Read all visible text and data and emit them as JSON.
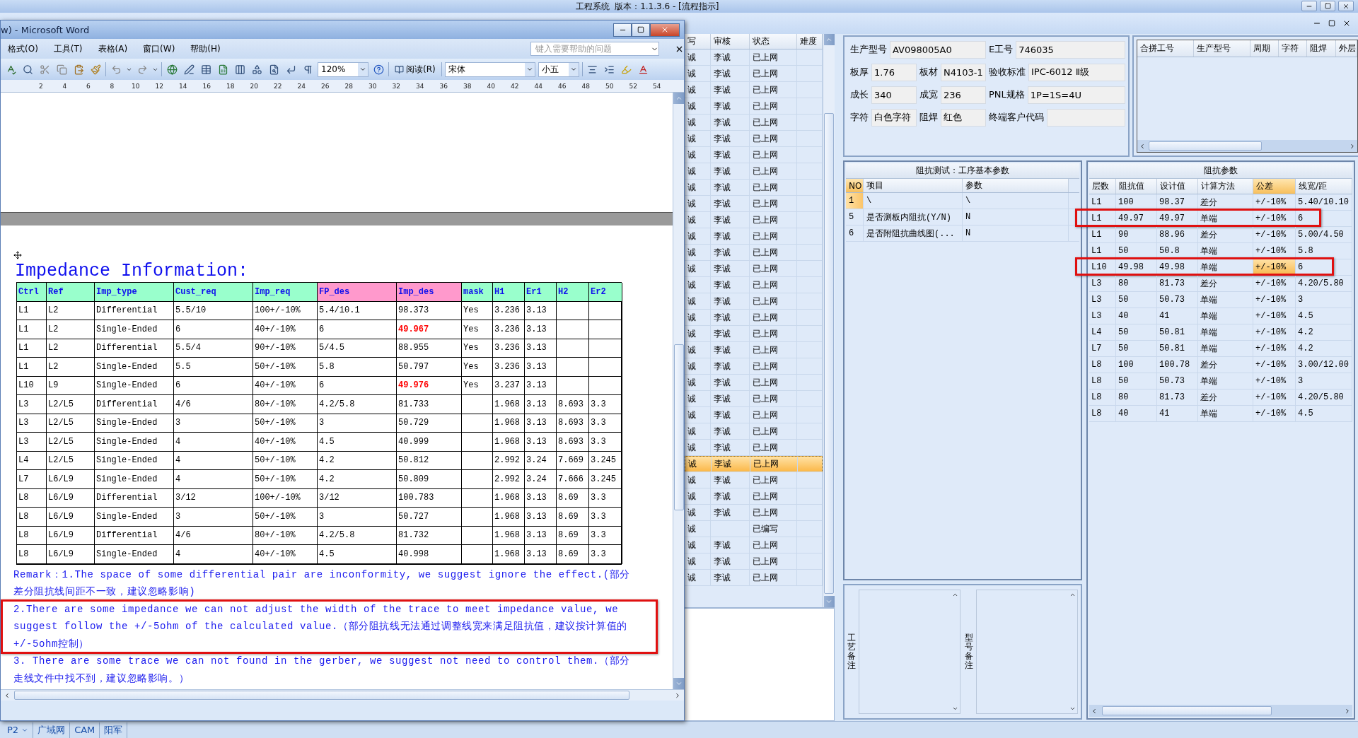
{
  "app": {
    "title": "工程系统  版本：1.1.3.6 - [流程指示]",
    "taskbar": [
      "P2",
      "广域网",
      "CAM",
      "阳军"
    ]
  },
  "word": {
    "title": "w) - Microsoft Word",
    "menu": [
      "格式(O)",
      "工具(T)",
      "表格(A)",
      "窗口(W)",
      "帮助(H)"
    ],
    "help_placeholder": "键入需要帮助的问题",
    "zoom": "120%",
    "read_button": "阅读(R)",
    "font": "宋体",
    "size": "小五",
    "ruler": [
      "2",
      "4",
      "6",
      "8",
      "10",
      "12",
      "14",
      "16",
      "18",
      "20",
      "22",
      "24",
      "26",
      "28",
      "30",
      "32",
      "34",
      "36",
      "38",
      "40",
      "42",
      "44",
      "46",
      "48",
      "50",
      "52",
      "54"
    ],
    "heading": "Impedance Information:",
    "table": {
      "columns": [
        {
          "label": "Ctrl",
          "color": "#99ffcc"
        },
        {
          "label": "Ref",
          "color": "#99ffcc"
        },
        {
          "label": "Imp_type",
          "color": "#99ffcc"
        },
        {
          "label": "Cust_req",
          "color": "#99ffcc"
        },
        {
          "label": "Imp_req",
          "color": "#99ffcc"
        },
        {
          "label": "FP_des",
          "color": "#ff99cc"
        },
        {
          "label": "Imp_des",
          "color": "#ff99cc"
        },
        {
          "label": "mask",
          "color": "#99ffcc"
        },
        {
          "label": "H1",
          "color": "#99ffcc"
        },
        {
          "label": "Er1",
          "color": "#99ffcc"
        },
        {
          "label": "H2",
          "color": "#99ffcc"
        },
        {
          "label": "Er2",
          "color": "#99ffcc"
        }
      ],
      "rows": [
        {
          "cells": [
            "L1",
            "L2",
            "Differential",
            "5.5/10",
            "100+/-10%",
            "5.4/10.1",
            "98.373",
            "Yes",
            "3.236",
            "3.13"
          ],
          "alert": false
        },
        {
          "cells": [
            "L1",
            "L2",
            "Single-Ended",
            "6",
            "40+/-10%",
            "6",
            "49.967",
            "Yes",
            "3.236",
            "3.13"
          ],
          "alert": true
        },
        {
          "cells": [
            "L1",
            "L2",
            "Differential",
            "5.5/4",
            "90+/-10%",
            "5/4.5",
            "88.955",
            "Yes",
            "3.236",
            "3.13"
          ],
          "alert": false
        },
        {
          "cells": [
            "L1",
            "L2",
            "Single-Ended",
            "5.5",
            "50+/-10%",
            "5.8",
            "50.797",
            "Yes",
            "3.236",
            "3.13"
          ],
          "alert": false
        },
        {
          "cells": [
            "L10",
            "L9",
            "Single-Ended",
            "6",
            "40+/-10%",
            "6",
            "49.976",
            "Yes",
            "3.237",
            "3.13"
          ],
          "alert": true
        },
        {
          "cells": [
            "L3",
            "L2/L5",
            "Differential",
            "4/6",
            "80+/-10%",
            "4.2/5.8",
            "81.733",
            "",
            "1.968",
            "3.13",
            "8.693",
            "3.3"
          ],
          "alert": false
        },
        {
          "cells": [
            "L3",
            "L2/L5",
            "Single-Ended",
            "3",
            "50+/-10%",
            "3",
            "50.729",
            "",
            "1.968",
            "3.13",
            "8.693",
            "3.3"
          ],
          "alert": false
        },
        {
          "cells": [
            "L3",
            "L2/L5",
            "Single-Ended",
            "4",
            "40+/-10%",
            "4.5",
            "40.999",
            "",
            "1.968",
            "3.13",
            "8.693",
            "3.3"
          ],
          "alert": false
        },
        {
          "cells": [
            "L4",
            "L2/L5",
            "Single-Ended",
            "4",
            "50+/-10%",
            "4.2",
            "50.812",
            "",
            "2.992",
            "3.24",
            "7.669",
            "3.245"
          ],
          "alert": false
        },
        {
          "cells": [
            "L7",
            "L6/L9",
            "Single-Ended",
            "4",
            "50+/-10%",
            "4.2",
            "50.809",
            "",
            "2.992",
            "3.24",
            "7.666",
            "3.245"
          ],
          "alert": false
        },
        {
          "cells": [
            "L8",
            "L6/L9",
            "Differential",
            "3/12",
            "100+/-10%",
            "3/12",
            "100.783",
            "",
            "1.968",
            "3.13",
            "8.69",
            "3.3"
          ],
          "alert": false
        },
        {
          "cells": [
            "L8",
            "L6/L9",
            "Single-Ended",
            "3",
            "50+/-10%",
            "3",
            "50.727",
            "",
            "1.968",
            "3.13",
            "8.69",
            "3.3"
          ],
          "alert": false
        },
        {
          "cells": [
            "L8",
            "L6/L9",
            "Differential",
            "4/6",
            "80+/-10%",
            "4.2/5.8",
            "81.732",
            "",
            "1.968",
            "3.13",
            "8.69",
            "3.3"
          ],
          "alert": false
        },
        {
          "cells": [
            "L8",
            "L6/L9",
            "Single-Ended",
            "4",
            "40+/-10%",
            "4.5",
            "40.998",
            "",
            "1.968",
            "3.13",
            "8.69",
            "3.3"
          ],
          "alert": false
        }
      ]
    },
    "remarks": [
      {
        "text": "Remark：1.The space of some differential pair are inconformity, we suggest ignore the effect.(部分差分阻抗线间距不一致，建议忽略影响)",
        "annotated": false
      },
      {
        "text": "2.There are some impedance we can not adjust the width of the trace to meet impedance value, we suggest follow the +/-5ohm of the calculated value.（部分阻抗线无法通过调整线宽来满足阻抗值，建议按计算值的+/-5ohm控制）",
        "annotated": true
      },
      {
        "text": "3. There are some trace we can not found in the gerber, we suggest not need to control them.（部分走线文件中找不到，建议忽略影响。）",
        "annotated": false
      }
    ]
  },
  "list": {
    "columns": [
      "写",
      "审核",
      "状态",
      "难度"
    ],
    "rows": [
      {
        "editor": "诚",
        "reviewer": "李诚",
        "status": "已上网",
        "selected": false
      },
      {
        "editor": "诚",
        "reviewer": "李诚",
        "status": "已上网",
        "selected": false
      },
      {
        "editor": "诚",
        "reviewer": "李诚",
        "status": "已上网",
        "selected": false
      },
      {
        "editor": "诚",
        "reviewer": "李诚",
        "status": "已上网",
        "selected": false
      },
      {
        "editor": "诚",
        "reviewer": "李诚",
        "status": "已上网",
        "selected": false
      },
      {
        "editor": "诚",
        "reviewer": "李诚",
        "status": "已上网",
        "selected": false
      },
      {
        "editor": "诚",
        "reviewer": "李诚",
        "status": "已上网",
        "selected": false
      },
      {
        "editor": "诚",
        "reviewer": "李诚",
        "status": "已上网",
        "selected": false
      },
      {
        "editor": "诚",
        "reviewer": "李诚",
        "status": "已上网",
        "selected": false
      },
      {
        "editor": "诚",
        "reviewer": "李诚",
        "status": "已上网",
        "selected": false
      },
      {
        "editor": "诚",
        "reviewer": "李诚",
        "status": "已上网",
        "selected": false
      },
      {
        "editor": "诚",
        "reviewer": "李诚",
        "status": "已上网",
        "selected": false
      },
      {
        "editor": "诚",
        "reviewer": "李诚",
        "status": "已上网",
        "selected": false
      },
      {
        "editor": "诚",
        "reviewer": "李诚",
        "status": "已上网",
        "selected": false
      },
      {
        "editor": "诚",
        "reviewer": "李诚",
        "status": "已上网",
        "selected": false
      },
      {
        "editor": "诚",
        "reviewer": "李诚",
        "status": "已上网",
        "selected": false
      },
      {
        "editor": "诚",
        "reviewer": "李诚",
        "status": "已上网",
        "selected": false
      },
      {
        "editor": "诚",
        "reviewer": "李诚",
        "status": "已上网",
        "selected": false
      },
      {
        "editor": "诚",
        "reviewer": "李诚",
        "status": "已上网",
        "selected": false
      },
      {
        "editor": "诚",
        "reviewer": "李诚",
        "status": "已上网",
        "selected": false
      },
      {
        "editor": "诚",
        "reviewer": "李诚",
        "status": "已上网",
        "selected": false
      },
      {
        "editor": "诚",
        "reviewer": "李诚",
        "status": "已上网",
        "selected": false
      },
      {
        "editor": "诚",
        "reviewer": "李诚",
        "status": "已上网",
        "selected": false
      },
      {
        "editor": "诚",
        "reviewer": "李诚",
        "status": "已上网",
        "selected": false
      },
      {
        "editor": "诚",
        "reviewer": "李诚",
        "status": "已上网",
        "selected": false
      },
      {
        "editor": "诚",
        "reviewer": "李诚",
        "status": "已上网",
        "selected": true
      },
      {
        "editor": "诚",
        "reviewer": "李诚",
        "status": "已上网",
        "selected": false
      },
      {
        "editor": "诚",
        "reviewer": "李诚",
        "status": "已上网",
        "selected": false
      },
      {
        "editor": "诚",
        "reviewer": "李诚",
        "status": "已上网",
        "selected": false
      },
      {
        "editor": "诚",
        "status": "已编写",
        "selected": false
      },
      {
        "editor": "诚",
        "reviewer": "李诚",
        "status": "已上网",
        "selected": false
      },
      {
        "editor": "诚",
        "reviewer": "李诚",
        "status": "已上网",
        "selected": false
      },
      {
        "editor": "诚",
        "reviewer": "李诚",
        "status": "已上网",
        "selected": false
      }
    ]
  },
  "form": {
    "fields": [
      {
        "label": "生产型号",
        "value": "AV098005A0"
      },
      {
        "label": "E工号",
        "value": "746035"
      },
      {
        "label": "板厚",
        "value": "1.76"
      },
      {
        "label": "板材",
        "value": "N4103-1"
      },
      {
        "label": "验收标准",
        "value": "IPC-6012 Ⅱ级"
      },
      {
        "label": "成长",
        "value": "340"
      },
      {
        "label": "成宽",
        "value": "236"
      },
      {
        "label": "PNL规格",
        "value": "1P=1S=4U"
      },
      {
        "label": "字符",
        "value": "白色字符"
      },
      {
        "label": "阻焊",
        "value": "红色"
      },
      {
        "label": "终端客户代码"
      }
    ]
  },
  "merge_grid": {
    "columns": [
      "合拼工号",
      "生产型号",
      "周期",
      "字符",
      "阻焊",
      "外层"
    ]
  },
  "impedance_test": {
    "title": "阻抗测试：工序基本参数",
    "columns": [
      {
        "label": "NO",
        "highlighted": true
      },
      {
        "label": "项目",
        "highlighted": false
      },
      {
        "label": "参数",
        "highlighted": false
      }
    ],
    "rows": [
      {
        "no": "1",
        "item": "\\",
        "param": "\\",
        "selected": true
      },
      {
        "no": "5",
        "item": "是否测板内阻抗(Y/N)",
        "param": "N",
        "selected": false
      },
      {
        "no": "6",
        "item": "是否附阻抗曲线图(...",
        "param": "N",
        "selected": false
      }
    ]
  },
  "notes": [
    {
      "label": "工艺备注"
    },
    {
      "label": "型号备注"
    }
  ],
  "impedance_params": {
    "title": "阻抗参数",
    "columns": [
      {
        "label": "层数",
        "highlighted": false
      },
      {
        "label": "阻抗值",
        "highlighted": false
      },
      {
        "label": "设计值",
        "highlighted": false
      },
      {
        "label": "计算方法",
        "highlighted": false
      },
      {
        "label": "公差",
        "highlighted": true
      },
      {
        "label": "线宽/距",
        "highlighted": false
      }
    ],
    "rows": [
      {
        "cells": [
          "L1",
          "100",
          "98.37",
          "差分",
          "+/-10%",
          "5.40/10.10"
        ],
        "annotated": false,
        "selected": false
      },
      {
        "cells": [
          "L1",
          "49.97",
          "49.97",
          "单端",
          "+/-10%",
          "6"
        ],
        "annotated": true,
        "selected": false
      },
      {
        "cells": [
          "L1",
          "90",
          "88.96",
          "差分",
          "+/-10%",
          "5.00/4.50"
        ],
        "annotated": false,
        "selected": false
      },
      {
        "cells": [
          "L1",
          "50",
          "50.8",
          "单端",
          "+/-10%",
          "5.8"
        ],
        "annotated": false,
        "selected": false
      },
      {
        "cells": [
          "L10",
          "49.98",
          "49.98",
          "单端",
          "+/-10%",
          "6"
        ],
        "annotated": true,
        "selected": true
      },
      {
        "cells": [
          "L3",
          "80",
          "81.73",
          "差分",
          "+/-10%",
          "4.20/5.80"
        ],
        "annotated": false,
        "selected": false
      },
      {
        "cells": [
          "L3",
          "50",
          "50.73",
          "单端",
          "+/-10%",
          "3"
        ],
        "annotated": false,
        "selected": false
      },
      {
        "cells": [
          "L3",
          "40",
          "41",
          "单端",
          "+/-10%",
          "4.5"
        ],
        "annotated": false,
        "selected": false
      },
      {
        "cells": [
          "L4",
          "50",
          "50.81",
          "单端",
          "+/-10%",
          "4.2"
        ],
        "annotated": false,
        "selected": false
      },
      {
        "cells": [
          "L7",
          "50",
          "50.81",
          "单端",
          "+/-10%",
          "4.2"
        ],
        "annotated": false,
        "selected": false
      },
      {
        "cells": [
          "L8",
          "100",
          "100.78",
          "差分",
          "+/-10%",
          "3.00/12.00"
        ],
        "annotated": false,
        "selected": false
      },
      {
        "cells": [
          "L8",
          "50",
          "50.73",
          "单端",
          "+/-10%",
          "3"
        ],
        "annotated": false,
        "selected": false
      },
      {
        "cells": [
          "L8",
          "80",
          "81.73",
          "差分",
          "+/-10%",
          "4.20/5.80"
        ],
        "annotated": false,
        "selected": false
      },
      {
        "cells": [
          "L8",
          "40",
          "41",
          "单端",
          "+/-10%",
          "4.5"
        ],
        "annotated": false,
        "selected": false
      }
    ]
  }
}
